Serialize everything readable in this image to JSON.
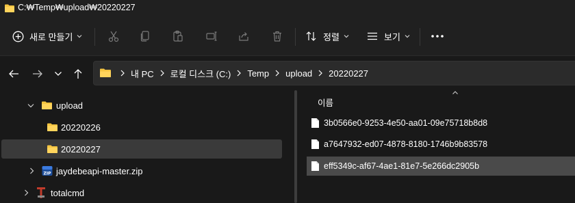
{
  "window": {
    "title": "C:₩Temp₩upload₩20220227"
  },
  "toolbar": {
    "new_label": "새로 만들기",
    "tools": [
      "cut-icon",
      "copy-icon",
      "paste-icon",
      "rename-icon",
      "share-icon",
      "delete-icon"
    ],
    "sort_label": "정렬",
    "view_label": "보기",
    "more_icon": "more-dots-icon"
  },
  "navigation": {
    "buttons": [
      "back-arrow-icon",
      "forward-arrow-icon",
      "recent-chevron-icon",
      "up-arrow-icon"
    ]
  },
  "address": {
    "crumbs": [
      "내 PC",
      "로컬 디스크 (C:)",
      "Temp",
      "upload",
      "20220227"
    ]
  },
  "sidebar": {
    "items": [
      {
        "label": "upload",
        "icon": "folder-icon",
        "expander": "chevron-down-icon",
        "selected": false
      },
      {
        "label": "20220226",
        "icon": "folder-icon",
        "expander": "",
        "selected": false
      },
      {
        "label": "20220227",
        "icon": "folder-icon",
        "expander": "",
        "selected": true
      },
      {
        "label": "jaydebeapi-master.zip",
        "icon": "zip-icon",
        "expander": "chevron-right-icon",
        "selected": false
      },
      {
        "label": "totalcmd",
        "icon": "totalcmd-icon",
        "expander": "chevron-right-icon",
        "selected": false
      }
    ]
  },
  "content": {
    "column_header": "이름",
    "sort_direction": "ascending",
    "files": [
      {
        "name": "3b0566e0-9253-4e50-aa01-09e75718b8d8",
        "selected": false
      },
      {
        "name": "a7647932-ed07-4878-8180-1746b9b83578",
        "selected": false
      },
      {
        "name": "eff5349c-af67-4ae1-81e7-5e266dc2905b",
        "selected": true
      }
    ]
  },
  "colors": {
    "background": "#191919",
    "toolbar_bg": "#202020",
    "address_bg": "#2b2b2b",
    "selection_nav": "#3a3a3a",
    "selection_file": "#4a4a4a",
    "folder": "#f5c541",
    "text": "#ffffff"
  }
}
